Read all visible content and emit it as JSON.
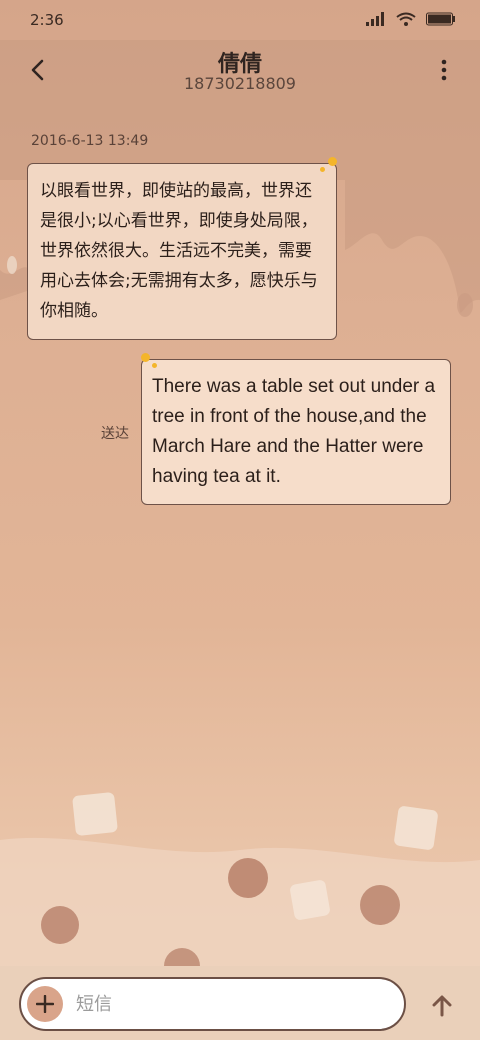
{
  "status_bar": {
    "time": "2:36"
  },
  "header": {
    "title": "倩倩",
    "subtitle": "18730218809"
  },
  "conversation": {
    "timestamp": "2016-6-13 13:49",
    "incoming_message": "以眼看世界，即使站的最高，世界还是很小;以心看世界，即使身处局限，世界依然很大。生活远不完美，需要用心去体会;无需拥有太多，愿快乐与你相随。",
    "outgoing_message": "There was a table set out under a tree in front of the house,and the March Hare and the Hatter were having tea at it.",
    "outgoing_status": "送达"
  },
  "composer": {
    "placeholder": "短信"
  },
  "colors": {
    "accent_spark": "#f4b52a",
    "bubble_border": "#6e5248",
    "plus_button": "#d9a48a"
  },
  "icons": [
    "back-arrow-icon",
    "more-vertical-icon",
    "signal-icon",
    "wifi-icon",
    "battery-icon",
    "plus-icon",
    "send-arrow-icon"
  ]
}
